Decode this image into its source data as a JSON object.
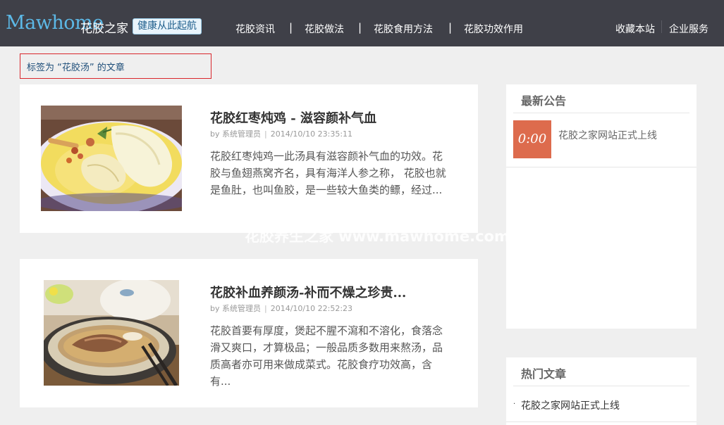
{
  "header": {
    "logo_en": "Mawhome",
    "logo_cn": "花胶之家",
    "slogan": "健康从此起航",
    "nav": [
      {
        "label": "花胶资讯"
      },
      {
        "label": "花胶做法"
      },
      {
        "label": "花胶食用方法"
      },
      {
        "label": "花胶功效作用"
      }
    ],
    "nav_separator": "|",
    "bookmark": "收藏本站",
    "enterprise": "企业服务"
  },
  "tag_heading": "标签为 “花胶汤” 的文章",
  "articles": [
    {
      "title": "花胶红枣炖鸡 - 滋容颜补气血",
      "by": "by",
      "author": "系统管理员",
      "date": "2014/10/10 23:35:11",
      "excerpt": "花胶红枣炖鸡一此汤具有滋容颜补气血的功效。花胶与鱼翅燕窝齐名，具有海洋人参之称， 花胶也就是鱼肚，也叫鱼胶，是一些较大鱼类的鳔，经过..."
    },
    {
      "title": "花胶补血养颜汤-补而不燥之珍贵...",
      "by": "by",
      "author": "系统管理员",
      "date": "2014/10/10 22:52:23",
      "excerpt": "花胶首要有厚度，煲起不腥不瀉和不溶化，食落念滑又爽口，才算极品；一般品质多数用来熬汤，品质高者亦可用来做成菜式。花胶食疗功效高，含有..."
    }
  ],
  "watermark": "花胶养生之家 www.mawhome.com",
  "sidebar": {
    "notice_title": "最新公告",
    "notice_date": "0:00",
    "notice_item": "花胶之家网站正式上线",
    "hot_title": "热门文章",
    "hot_bullet": "·",
    "hot_item": "花胶之家网站正式上线"
  },
  "colors": {
    "header_bg": "#3f4048",
    "logo_blue": "#5cb8e6",
    "page_bg": "#efefef",
    "tag_border": "#d9262c",
    "date_badge": "#dd6b4d"
  }
}
